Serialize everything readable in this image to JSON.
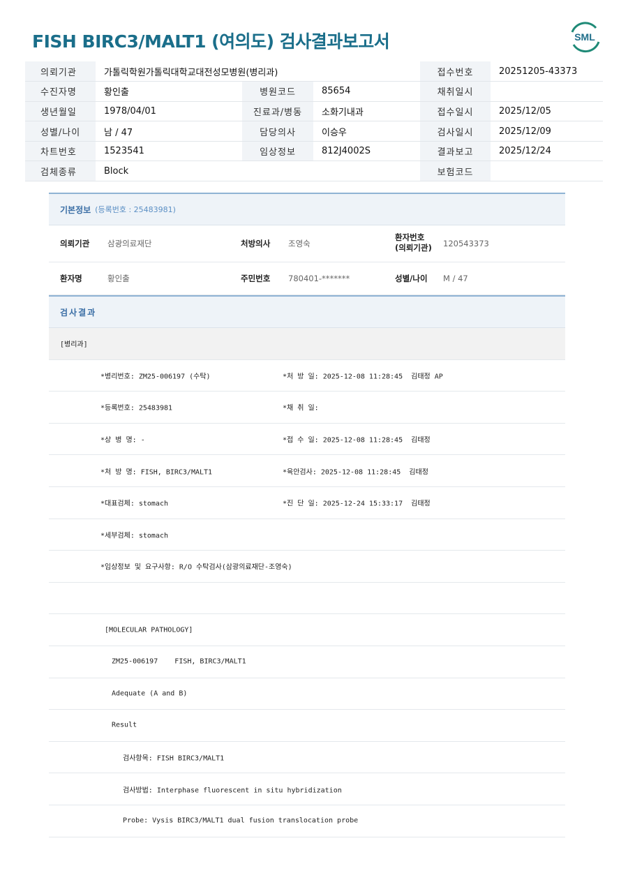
{
  "report": {
    "title": "FISH BIRC3/MALT1 (여의도) 검사결과보고서",
    "logo_text": "SML"
  },
  "header_table": {
    "r1": {
      "l1": "의뢰기관",
      "v1": "가톨릭학원가톨릭대학교대전성모병원(병리과)",
      "l3": "접수번호",
      "v3": "20251205-43373"
    },
    "r2": {
      "l1": "수진자명",
      "v1": "황인출",
      "l2": "병원코드",
      "v2": "85654",
      "l3": "채취일시",
      "v3": ""
    },
    "r3": {
      "l1": "생년월일",
      "v1": "1978/04/01",
      "l2": "진료과/병동",
      "v2": "소화기내과",
      "l3": "접수일시",
      "v3": "2025/12/05"
    },
    "r4": {
      "l1": "성별/나이",
      "v1": "남 / 47",
      "l2": "담당의사",
      "v2": "이승우",
      "l3": "검사일시",
      "v3": "2025/12/09"
    },
    "r5": {
      "l1": "차트번호",
      "v1": "1523541",
      "l2": "임상정보",
      "v2": "812J4002S",
      "l3": "결과보고",
      "v3": "2025/12/24"
    },
    "r6": {
      "l1": "검체종류",
      "v1": "Block",
      "l3": "보험코드",
      "v3": ""
    }
  },
  "basic_info": {
    "heading": "기본정보",
    "reg": "(등록번호 : 25483981)",
    "rows": [
      {
        "k1": "의뢰기관",
        "v1": "삼광의료재단",
        "k2": "처방의사",
        "v2": "조영숙",
        "k3a": "환자번호",
        "k3b": "(의뢰기관)",
        "v3": "120543373"
      },
      {
        "k1": "환자명",
        "v1": "황인출",
        "k2": "주민번호",
        "v2": "780401-*******",
        "k3a": "성별/나이",
        "v3": "M / 47"
      }
    ]
  },
  "result": {
    "heading": "검사결과",
    "dept": "[병리과]",
    "lines": [
      {
        "a": "*병리번호: ZM25-006197 (수탁)",
        "b": "*처 방 일: 2025-12-08 11:28:45  김태정 AP"
      },
      {
        "a": "*등록번호: 25483981",
        "b": "*채 취 일:"
      },
      {
        "a": "*상 병 명: -",
        "b": "*접 수 일: 2025-12-08 11:28:45  김태정"
      },
      {
        "a": "*처 방 명: FISH, BIRC3/MALT1",
        "b": "*육안검사: 2025-12-08 11:28:45  김태정"
      },
      {
        "a": "*대표검체: stomach",
        "b": "*진 단 일: 2025-12-24 15:33:17  김태정"
      },
      {
        "a": "*세부검체: stomach",
        "b": ""
      },
      {
        "a": "*임상정보 및 요구사항: R/O 수탁검사(삼광의료재단-조영숙)",
        "b": ""
      },
      {
        "a": "",
        "b": ""
      },
      {
        "a": "[MOLECULAR PATHOLOGY]",
        "b": ""
      },
      {
        "a": "ZM25-006197    FISH, BIRC3/MALT1",
        "b": ""
      },
      {
        "a": "Adequate (A and B)",
        "b": ""
      },
      {
        "a": "Result",
        "b": ""
      },
      {
        "a": "검사항목: FISH BIRC3/MALT1",
        "b": ""
      },
      {
        "a": "검사방법: Interphase fluorescent in situ hybridization",
        "b": ""
      },
      {
        "a": "Probe: Vysis BIRC3/MALT1 dual fusion translocation probe",
        "b": ""
      }
    ]
  },
  "colors": {
    "title": "#1a6e8a",
    "accent": "#3a6ea5",
    "logo_green": "#1f8a77"
  }
}
